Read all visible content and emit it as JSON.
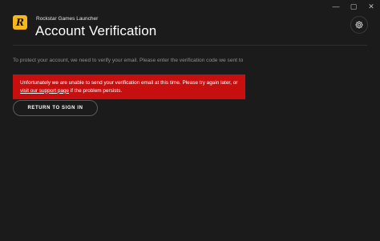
{
  "window": {
    "minimize_glyph": "—",
    "maximize_glyph": "▢",
    "close_glyph": "✕"
  },
  "header": {
    "logo_letter": "R",
    "app_name": "Rockstar Games Launcher",
    "title": "Account Verification",
    "settings_icon": "gear-icon"
  },
  "main": {
    "intro_text": "To protect your account, we need to verify your email. Please enter the verification code we sent to",
    "error": {
      "text_before_link": "Unfortunately we are unable to send your verification email at this time. Please try again later, or ",
      "link_text": "visit our support page",
      "text_after_link": " if the problem persists."
    },
    "return_button_label": "RETURN TO SIGN IN"
  },
  "colors": {
    "background": "#1b1b1b",
    "error_background": "#c70f0f",
    "logo_accent": "#f5b71b"
  }
}
